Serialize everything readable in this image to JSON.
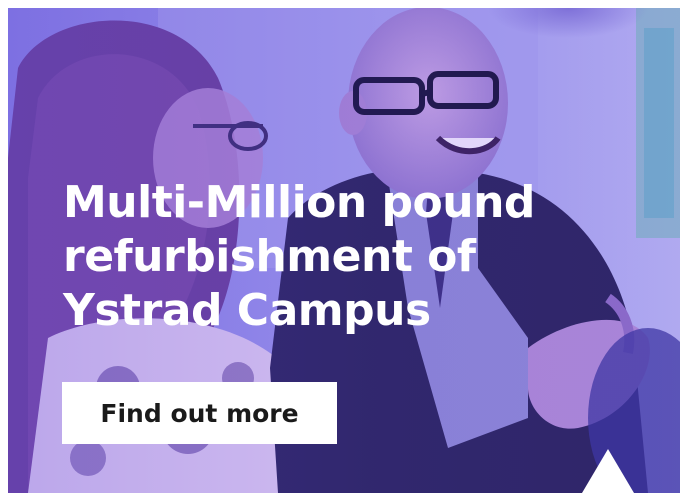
{
  "hero": {
    "headline": "Multi-Million pound refurbishment of Ystrad Campus",
    "cta_label": "Find out more",
    "image_alt": "Smiling man with glasses talking with a woman at an event",
    "colors": {
      "overlay": "#5c46d2",
      "headline": "#ffffff",
      "cta_background": "#ffffff",
      "cta_text": "#1a1a1a"
    },
    "icons": {
      "carousel_indicator": "up-triangle-icon"
    }
  }
}
